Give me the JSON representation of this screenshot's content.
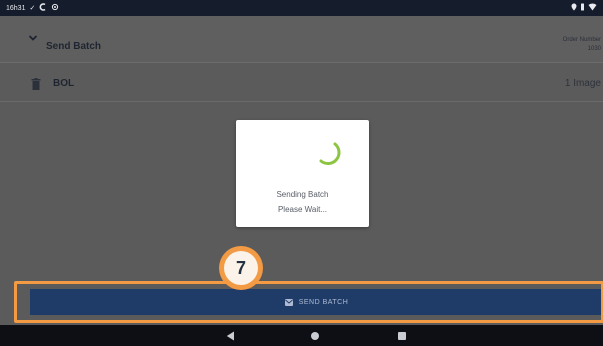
{
  "status_bar": {
    "time": "16h31",
    "left_icons": [
      "check-icon",
      "c-icon",
      "settings-icon"
    ],
    "right_icons": [
      "location-icon",
      "wifi-icon"
    ]
  },
  "header": {
    "title": "Send Batch",
    "order_number_label": "Order Number",
    "order_number_value": "1030"
  },
  "bol_row": {
    "label": "BOL",
    "images_count": "1 Image"
  },
  "dialog": {
    "line1": "Sending Batch",
    "line2": "Please Wait..."
  },
  "send_button": {
    "label": "SEND BATCH"
  },
  "callout": {
    "number": "7"
  },
  "colors": {
    "status_bar": "#151c2c",
    "overlay": "#5b5b5b",
    "button": "#1f3c69",
    "highlight": "#f39a44",
    "spinner": "#8cc542",
    "nav_bar": "#0d0f14"
  }
}
